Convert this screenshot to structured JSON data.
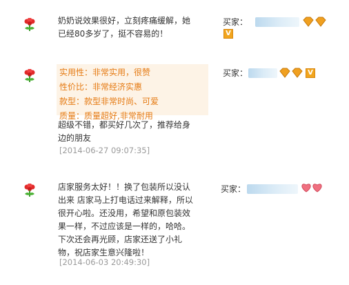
{
  "reviews": [
    {
      "comment_lines": [
        "奶奶说效果很好，立刻疼痛缓解，她",
        "已经80多岁了，挺不容易的！"
      ],
      "buyer_label": "买家：",
      "badge": "diamond-rank",
      "diamond_count": 2,
      "has_vip": true
    },
    {
      "tags": [
        {
          "label": "实用性：",
          "value": "非常实用，很赞"
        },
        {
          "label": "性价比：",
          "value": "非常经济实惠"
        },
        {
          "label": "款型：",
          "value": "款型非常时尚、可爱"
        },
        {
          "label": "质量：",
          "value": "质量超好,非常耐用"
        }
      ],
      "comment_lines": [
        "超级不错，都买好几次了，推荐给身",
        "边的朋友"
      ],
      "date": "[2014-06-27 09:07:35]",
      "buyer_label": "买家：",
      "badge": "diamond-rank",
      "diamond_count": 2,
      "has_vip": true
    },
    {
      "comment_lines": [
        "店家服务太好！！换了包装所以没认",
        "出来 店家马上打电话过来解释，所以",
        "很开心啦。还没用，希望和原包装效",
        "果一样，不过应该是一样的，哈哈。",
        "下次还会再光顾，店家还送了小礼",
        "物，祝店家生意兴隆啦！"
      ],
      "date": "[2014-06-03 20:49:30]",
      "buyer_label": "买家：",
      "badge": "heart-rank",
      "heart_count": 2,
      "has_vip": false
    }
  ],
  "colors": {
    "tag_text": "#e57a12",
    "tag_background": "#fdf3e6",
    "date_text": "#9a9a9a",
    "diamond": "#f0a020",
    "heart": "#f07080"
  }
}
